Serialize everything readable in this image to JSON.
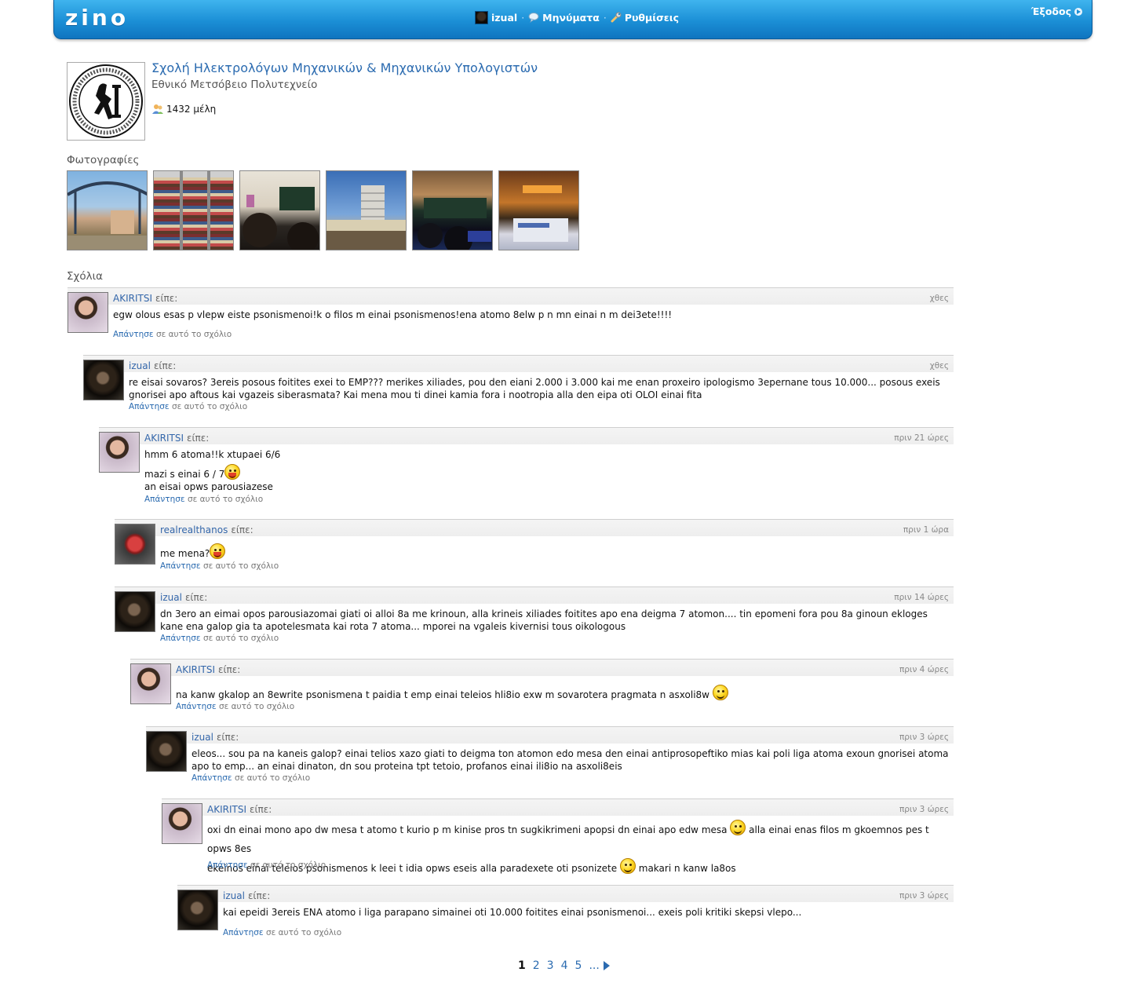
{
  "topbar": {
    "logo": "zino",
    "user": "izual",
    "messages": "Μηνύματα",
    "settings": "Ρυθμίσεις",
    "separator": "·",
    "logout": "Έξοδος"
  },
  "group": {
    "title": "Σχολή Ηλεκτρολόγων Μηχανικών & Μηχανικών Υπολογιστών",
    "subtitle": "Εθνικό Μετσόβειο Πολυτεχνείο",
    "members": "1432 μέλη"
  },
  "photos_title": "Φωτογραφίες",
  "comments_title": "Σχόλια",
  "said": "είπε:",
  "reply_link": "Απάντησε",
  "reply_suffix": "σε αυτό το σχόλιο",
  "comments": [
    {
      "author": "AKIRITSI",
      "time": "χθες",
      "lines": [
        "egw olous esas p vlepw eiste psonismenoi!k o filos m einai psonismenos!ena atomo 8elw p n mn einai n m dei3ete!!!!"
      ]
    },
    {
      "author": "izual",
      "time": "χθες",
      "lines": [
        "re eisai sovaros? 3ereis posous foitites exei to EMP??? merikes xiliades, pou den eiani 2.000 i 3.000 kai me enan proxeiro ipologismo 3epernane tous 10.000... posous exeis gnorisei apo aftous kai vgazeis siberasmata? Kai mena mou ti dinei kamia fora i nootropia alla den eipa oti OLOI einai fita"
      ]
    },
    {
      "author": "AKIRITSI",
      "time": "πριν 21 ώρες",
      "lines": [
        "hmm 6 atoma!!k xtupaei 6/6",
        "mazi s einai 6 / 7",
        "an eisai opws parousiazese"
      ]
    },
    {
      "author": "realrealthanos",
      "time": "πριν 1 ώρα",
      "lines": [
        "me mena?"
      ]
    },
    {
      "author": "izual",
      "time": "πριν 14 ώρες",
      "lines": [
        "dn 3ero an eimai opos parousiazomai giati oi alloi 8a me krinoun, alla krineis xiliades foitites apo ena deigma 7 atomon.... tin epomeni fora pou 8a ginoun ekloges kane ena galop gia ta apotelesmata kai rota 7 atoma... mporei na vgaleis kivernisi tous oikologous"
      ]
    },
    {
      "author": "AKIRITSI",
      "time": "πριν 4 ώρες",
      "lines": [
        "na kanw gkalop an 8ewrite psonismena t paidia t emp einai teleios hli8io exw m sovarotera pragmata n asxoli8w"
      ]
    },
    {
      "author": "izual",
      "time": "πριν 3 ώρες",
      "lines": [
        "eleos... sou pa na kaneis galop? einai telios xazo giati to deigma ton atomon edo mesa den einai antiprosopeftiko mias kai poli liga atoma exoun gnorisei atoma apo to emp... an einai dinaton, dn sou proteina tpt tetoio, profanos einai ili8io na asxoli8eis"
      ]
    },
    {
      "author": "AKIRITSI",
      "time": "πριν 3 ώρες",
      "lines": [
        "oxi dn einai mono apo dw mesa t atomo t kurio p m kinise pros tn sugkikrimeni apopsi dn einai apo edw mesa",
        "alla einai enas filos m gkoemnos pes t opws 8es",
        "ekeinos einai teleios psonismenos k leei t idia opws eseis alla paradexete oti psonizete",
        "makari n kanw la8os"
      ]
    },
    {
      "author": "izual",
      "time": "πριν 3 ώρες",
      "lines": [
        "kai epeidi 3ereis ENA atomo i liga parapano simainei oti 10.000 foitites einai psonismenoi... exeis poli kritiki skepsi vlepo..."
      ]
    }
  ],
  "pagination": {
    "current": "1",
    "pages": [
      "2",
      "3",
      "4",
      "5"
    ],
    "more": "..."
  }
}
